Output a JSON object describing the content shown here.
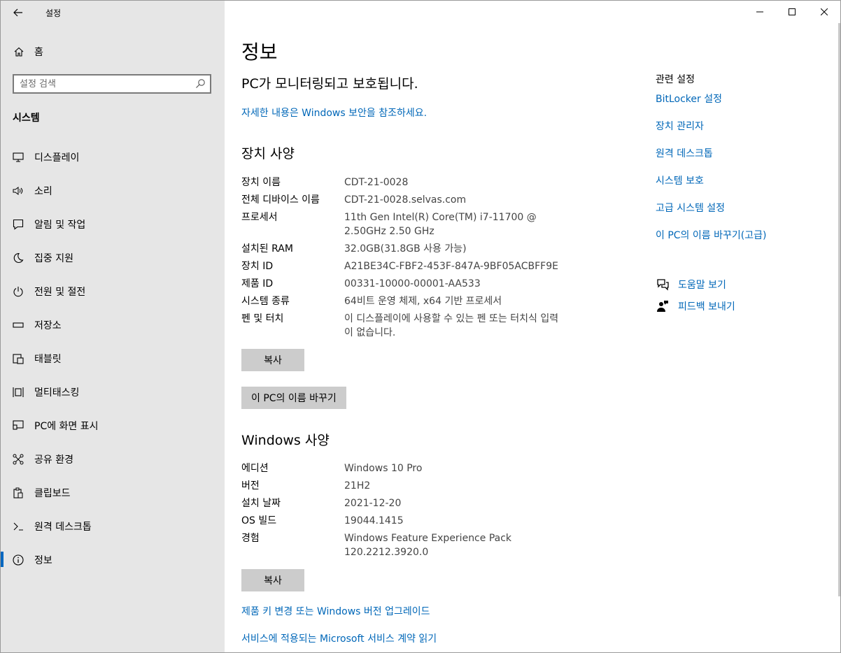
{
  "window": {
    "title": "설정"
  },
  "sidebar": {
    "home_label": "홈",
    "search_placeholder": "설정 검색",
    "section_title": "시스템",
    "items": [
      {
        "label": "디스플레이",
        "icon": "monitor-icon"
      },
      {
        "label": "소리",
        "icon": "speaker-icon"
      },
      {
        "label": "알림 및 작업",
        "icon": "notification-icon"
      },
      {
        "label": "집중 지원",
        "icon": "moon-icon"
      },
      {
        "label": "전원 및 절전",
        "icon": "power-icon"
      },
      {
        "label": "저장소",
        "icon": "storage-icon"
      },
      {
        "label": "태블릿",
        "icon": "tablet-icon"
      },
      {
        "label": "멀티태스킹",
        "icon": "multitasking-icon"
      },
      {
        "label": "PC에 화면 표시",
        "icon": "project-icon"
      },
      {
        "label": "공유 환경",
        "icon": "share-icon"
      },
      {
        "label": "클립보드",
        "icon": "clipboard-icon"
      },
      {
        "label": "원격 데스크톱",
        "icon": "remote-desktop-icon"
      },
      {
        "label": "정보",
        "icon": "info-icon",
        "selected": true
      }
    ]
  },
  "main": {
    "title": "정보",
    "protection_text": "PC가 모니터링되고 보호됩니다.",
    "security_link": "자세한 내용은 Windows 보안을 참조하세요.",
    "device_spec_title": "장치 사양",
    "device_specs": [
      {
        "key": "장치 이름",
        "value": "CDT-21-0028"
      },
      {
        "key": "전체 디바이스 이름",
        "value": "CDT-21-0028.selvas.com"
      },
      {
        "key": "프로세서",
        "value": "11th Gen Intel(R) Core(TM) i7-11700 @ 2.50GHz   2.50 GHz"
      },
      {
        "key": "설치된 RAM",
        "value": "32.0GB(31.8GB 사용 가능)"
      },
      {
        "key": "장치 ID",
        "value": "A21BE34C-FBF2-453F-847A-9BF05ACBFF9E"
      },
      {
        "key": "제품 ID",
        "value": "00331-10000-00001-AA533"
      },
      {
        "key": "시스템 종류",
        "value": "64비트 운영 체제, x64 기반 프로세서"
      },
      {
        "key": "펜 및 터치",
        "value": "이 디스플레이에 사용할 수 있는 펜 또는 터치식 입력이 없습니다."
      }
    ],
    "copy_label": "복사",
    "rename_label": "이 PC의 이름 바꾸기",
    "windows_spec_title": "Windows 사양",
    "windows_specs": [
      {
        "key": "에디션",
        "value": "Windows 10 Pro"
      },
      {
        "key": "버전",
        "value": "21H2"
      },
      {
        "key": "설치 날짜",
        "value": "2021-12-20"
      },
      {
        "key": "OS 빌드",
        "value": "19044.1415"
      },
      {
        "key": "경험",
        "value": "Windows Feature Experience Pack 120.2212.3920.0"
      }
    ],
    "copy_label_2": "복사",
    "product_key_link": "제품 키 변경 또는 Windows 버전 업그레이드",
    "service_link": "서비스에 적용되는 Microsoft 서비스 계약 읽기"
  },
  "related": {
    "title": "관련 설정",
    "links": [
      "BitLocker 설정",
      "장치 관리자",
      "원격 데스크톱",
      "시스템 보호",
      "고급 시스템 설정",
      "이 PC의 이름 바꾸기(고급)"
    ],
    "help_label": "도움말 보기",
    "feedback_label": "피드백 보내기"
  },
  "colors": {
    "accent": "#0067b8",
    "sidebar_bg": "#e6e6e6",
    "button_bg": "#cccccc"
  }
}
